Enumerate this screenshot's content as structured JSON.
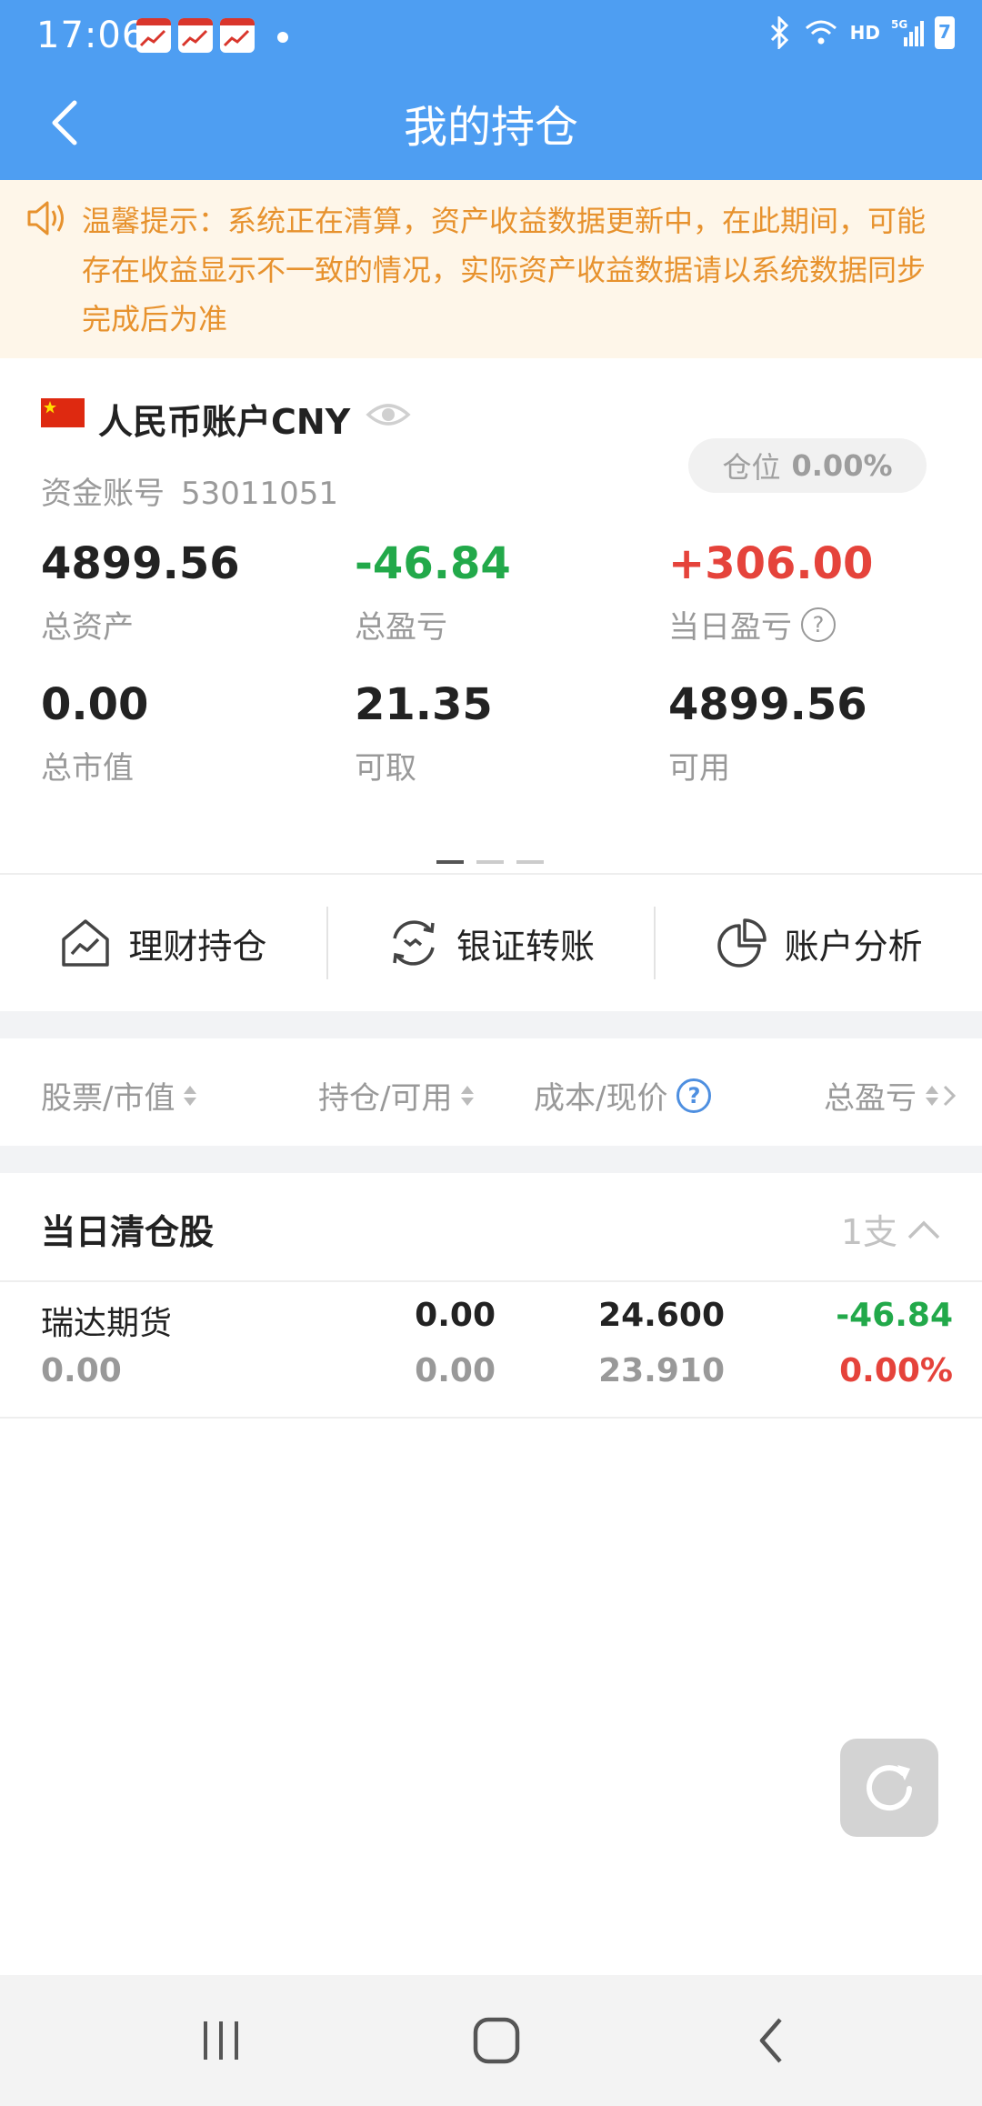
{
  "status_bar": {
    "time": "17:06",
    "network": "HD",
    "battery_level": "7"
  },
  "header": {
    "title": "我的持仓"
  },
  "notice": {
    "text": "温馨提示：系统正在清算，资产收益数据更新中，在此期间，可能存在收益显示不一致的情况，实际资产收益数据请以系统数据同步完成后为准"
  },
  "account": {
    "title": "人民币账户CNY",
    "account_label": "资金账号",
    "account_number": "53011051",
    "position_label": "仓位",
    "position_value": "0.00%",
    "stats": [
      {
        "value": "4899.56",
        "label": "总资产"
      },
      {
        "value": "-46.84",
        "label": "总盈亏"
      },
      {
        "value": "+306.00",
        "label": "当日盈亏"
      },
      {
        "value": "0.00",
        "label": "总市值"
      },
      {
        "value": "21.35",
        "label": "可取"
      },
      {
        "value": "4899.56",
        "label": "可用"
      }
    ],
    "help_glyph": "?"
  },
  "actions": [
    {
      "label": "理财持仓",
      "icon": "house-chart-icon"
    },
    {
      "label": "银证转账",
      "icon": "transfer-icon"
    },
    {
      "label": "账户分析",
      "icon": "pie-chart-icon"
    }
  ],
  "table_header": {
    "col1": "股票/市值",
    "col2": "持仓/可用",
    "col3": "成本/现价",
    "col4": "总盈亏",
    "help_glyph": "?"
  },
  "section": {
    "title": "当日清仓股",
    "count": "1支"
  },
  "stocks": [
    {
      "name": "瑞达期货",
      "market_value": "0.00",
      "holding": "0.00",
      "available": "0.00",
      "cost": "24.600",
      "price": "23.910",
      "pnl": "-46.84",
      "pnl_pct": "0.00%"
    }
  ],
  "colors": {
    "header_bg": "#4e9ef2",
    "notice_bg": "#fef6e9",
    "notice_text": "#e7922e",
    "gain": "#e5433b",
    "loss": "#22a94a"
  }
}
